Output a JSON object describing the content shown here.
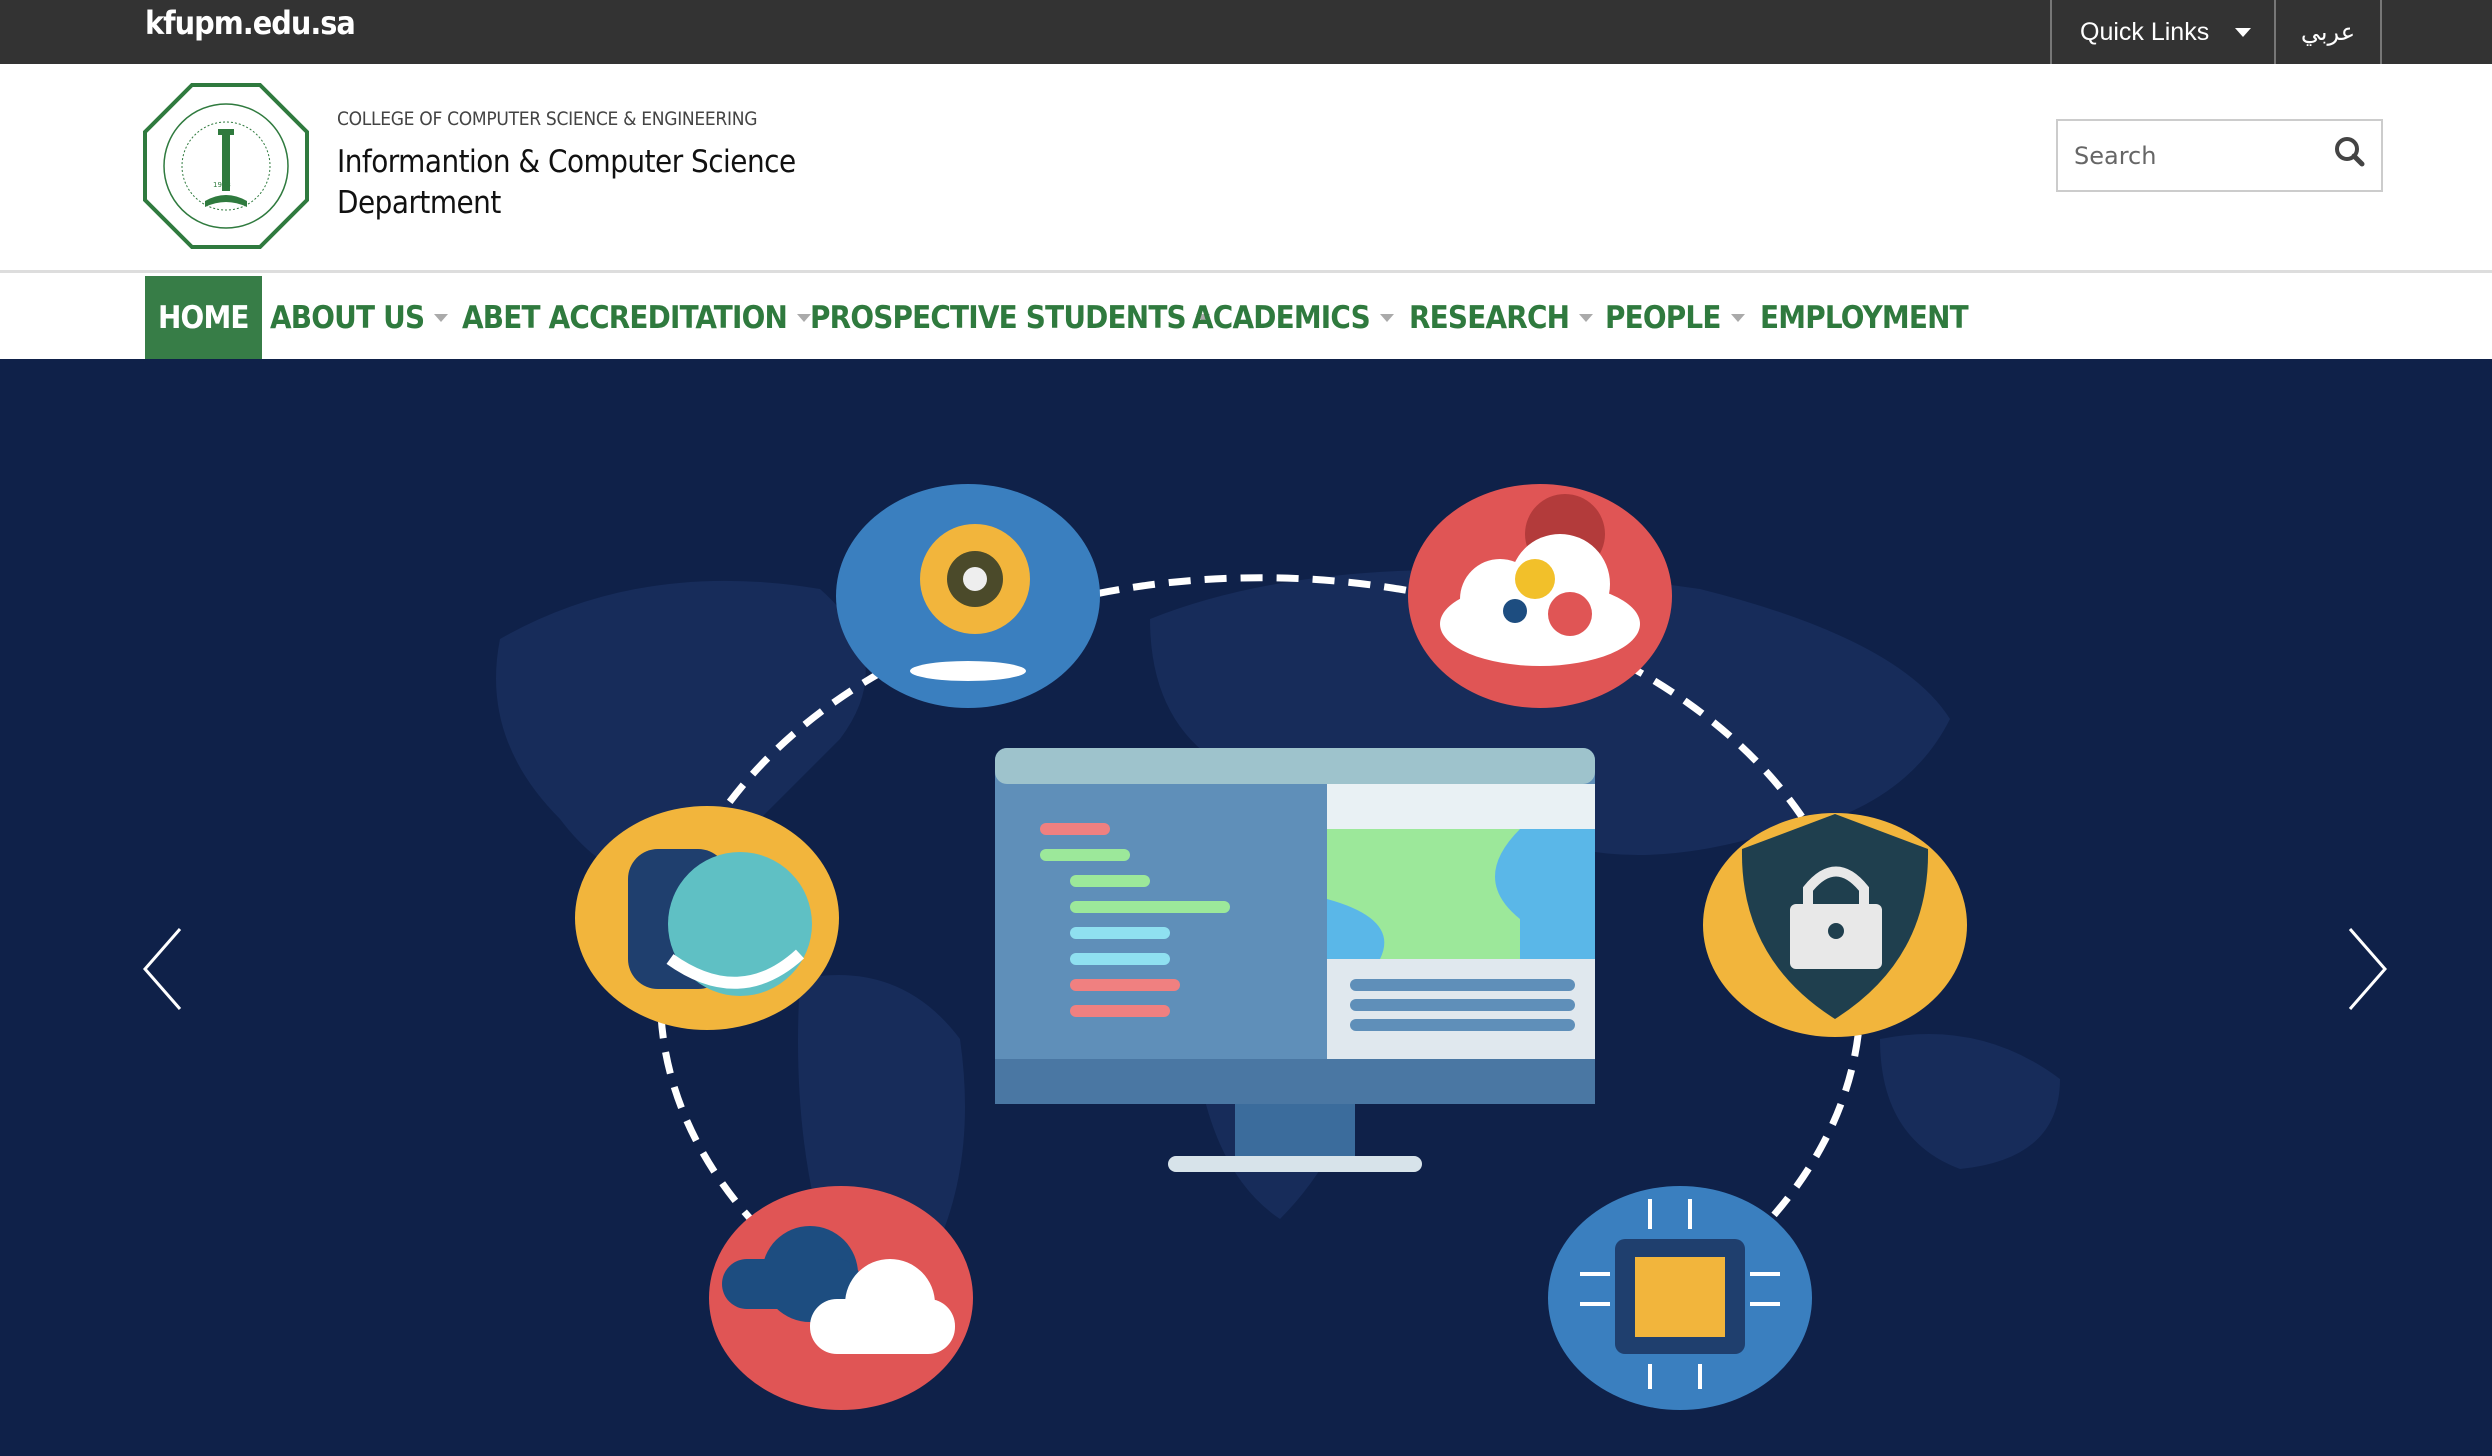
{
  "topbar": {
    "site": "kfupm.edu.sa",
    "quick_links": "Quick Links",
    "arabic": "عربي"
  },
  "header": {
    "college": "COLLEGE OF COMPUTER SCIENCE & ENGINEERING",
    "dept_line1": "Informantion & Computer Science",
    "dept_line2": "Department",
    "logo_text": "KING FAHD UNIVERSITY OF PETROLEUM & MINERALS 1963",
    "search": {
      "placeholder": "Search",
      "value": ""
    }
  },
  "nav": {
    "items": [
      {
        "label": "HOME",
        "active": true
      },
      {
        "label": "ABOUT US",
        "dropdown": true
      },
      {
        "label": "ABET ACCREDITATION",
        "dropdown": true
      },
      {
        "label": "PROSPECTIVE STUDENTS",
        "dropdown": true
      },
      {
        "label": "ACADEMICS",
        "dropdown": true
      },
      {
        "label": "RESEARCH",
        "dropdown": true
      },
      {
        "label": "PEOPLE",
        "dropdown": true
      },
      {
        "label": "EMPLOYMENT"
      }
    ]
  },
  "hero": {
    "slide_icons": [
      "ai-head-icon",
      "cloud-gears-icon",
      "database-globe-icon",
      "shield-lock-icon",
      "cloud-sync-icon",
      "chip-icon",
      "monitor-code-icon"
    ],
    "colors": {
      "background": "#0f2149",
      "blue": "#3a7fbf",
      "red": "#e05555",
      "yellow": "#f2b53c"
    }
  },
  "colors": {
    "brand_green": "#377d47",
    "topbar": "#333333"
  }
}
